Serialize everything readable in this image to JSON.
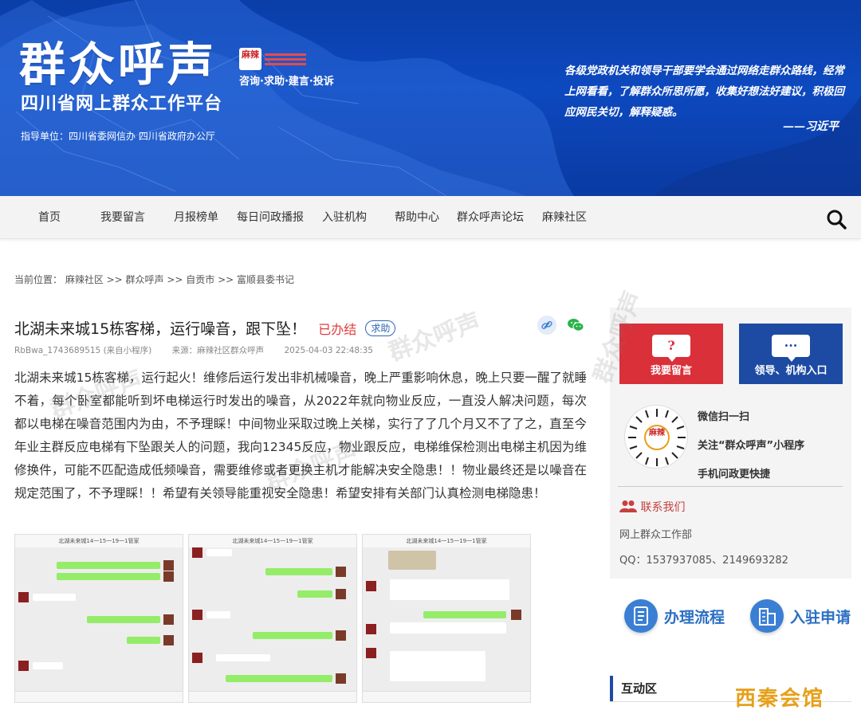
{
  "banner": {
    "title": "群众呼声",
    "mala_logo": "麻辣",
    "slogan": "咨询·求助·建言·投诉",
    "subtitle": "四川省网上群众工作平台",
    "guide": "指导单位：四川省委网信办  四川省政府办公厅",
    "quote": "各级党政机关和领导干部要学会通过网络走群众路线，经常上网看看，了解群众所思所愿，收集好想法好建议，积极回应网民关切，解释疑惑。",
    "quote_author": "——习近平",
    "colors": {
      "primary": "#0d49bf"
    }
  },
  "nav": {
    "items": [
      "首页",
      "我要留言",
      "月报榜单",
      "每日问政播报",
      "入驻机构",
      "帮助中心",
      "群众呼声论坛",
      "麻辣社区"
    ],
    "search_icon": "search-icon"
  },
  "breadcrumb": "当前位置：  麻辣社区 >> 群众呼声 >> 自贡市 >> 富顺县委书记",
  "article": {
    "title": "北湖未来城15栋客梯，运行噪音，跟下坠！",
    "status": "已办结",
    "tag": "求助",
    "author": "RbBwa_1743689515 (来自小程序)",
    "source": "来源：麻辣社区群众呼声",
    "time": "2025-04-03 22:48:35",
    "body": "北湖未来城15栋客梯，运行起火！维修后运行发出非机械噪音，晚上严重影响休息，晚上只要一醒了就睡不着，每个卧室都能听到坏电梯运行时发出的噪音，从2022年就向物业反应，一直没人解决问题，每次都以电梯在噪音范围内为由，不予理睬！中间物业采取过晚上关梯，实行了了几个月又不了了之，直至今年业主群反应电梯有下坠跟关人的问题，我向12345反应，物业跟反应，电梯维保检测出电梯主机因为维修换件，可能不匹配造成低频噪音，需要维修或者更换主机才能解决安全隐患！！物业最终还是以噪音在规定范围了，不予理睬！！希望有关领导能重视安全隐患！希望安排有关部门认真检测电梯隐患！",
    "screenshot_titles": [
      "北湖未来城14一15一19一1管家",
      "北湖未来城14一15一19一1管家",
      "北湖未来城14一15一19一1管家"
    ],
    "share_icons": [
      "link-icon",
      "wechat-icon"
    ]
  },
  "sidebar": {
    "ask_label": "我要留言",
    "entry_label": "领导、机构入口",
    "qr_lines": [
      "微信扫一扫",
      "关注“群众呼声”小程序",
      "手机问政更快捷"
    ],
    "qr_logo": "麻辣",
    "contact_title": "联系我们",
    "contact_dept": "网上群众工作部",
    "contact_qq": "QQ：1537937085、2149693282",
    "process_label": "办理流程",
    "settle_label": "入驻申请",
    "interact_title": "互动区"
  },
  "watermark": {
    "text": "群众呼声",
    "corner_logo": "西秦会馆"
  }
}
